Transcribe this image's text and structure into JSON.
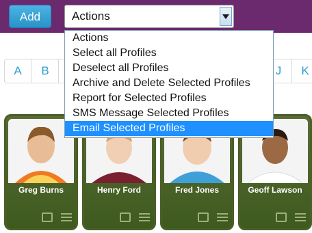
{
  "toolbar": {
    "add_label": "Add"
  },
  "actions_select": {
    "value": "Actions"
  },
  "dropdown": {
    "options": [
      "Actions",
      "Select all Profiles",
      "Deselect all Profiles",
      "Archive and Delete Selected Profiles",
      "Report for Selected Profiles",
      "SMS Message Selected Profiles",
      "Email Selected Profiles"
    ],
    "selected_index": 6
  },
  "alphabet": {
    "visible_letters": [
      "A",
      "B",
      "J",
      "K"
    ]
  },
  "profiles": [
    {
      "name": "Greg Burns"
    },
    {
      "name": "Henry Ford"
    },
    {
      "name": "Fred Jones"
    },
    {
      "name": "Geoff Lawson"
    }
  ],
  "colors": {
    "toolbar_bg": "#6b2a6e",
    "add_button": "#2f9fd6",
    "dropdown_highlight": "#1e90ff",
    "card_bg": "#4a5f27"
  }
}
